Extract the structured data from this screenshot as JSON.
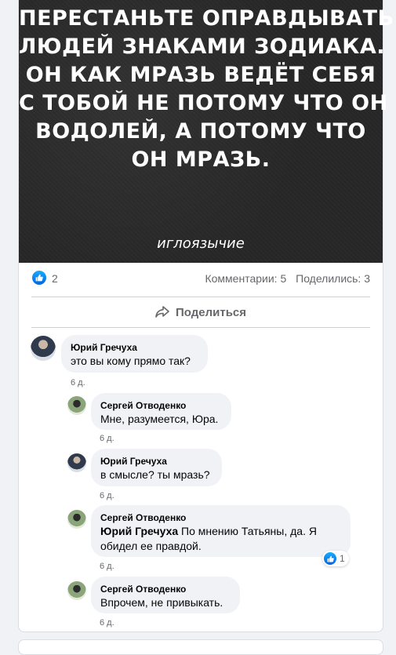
{
  "post": {
    "meme_lines": [
      "ПЕРЕСТАНЬТЕ ОПРАВДЫВАТЬ",
      "ЛЮДЕЙ ЗНАКАМИ ЗОДИАКА.",
      "ОН КАК МРАЗЬ ВЕДЁТ СЕБЯ",
      "С ТОБОЙ НЕ ПОТОМУ ЧТО ОН",
      "ВОДОЛЕЙ, А ПОТОМУ ЧТО",
      "ОН МРАЗЬ."
    ],
    "watermark": "иглоязычие",
    "likes": "2",
    "comments": "Комментарии: 5",
    "shares": "Поделились: 3",
    "share_label": "Поделиться"
  },
  "comments": [
    {
      "author": "Юрий Гречуха",
      "text": "это вы кому прямо так?",
      "time": "6 д."
    },
    {
      "author": "Сергей Отводенко",
      "text": "Мне, разумеется, Юра.",
      "time": "6 д."
    },
    {
      "author": "Юрий Гречуха",
      "text": "в смысле? ты мразь?",
      "time": "6 д."
    },
    {
      "author": "Сергей Отводенко",
      "mention": "Юрий Гречуха",
      "text": " По мнению Татьяны, да. Я обидел ее правдой.",
      "time": "6 д.",
      "reactions": "1"
    },
    {
      "author": "Сергей Отводенко",
      "text": "Впрочем, не привыкать.",
      "time": "6 д."
    }
  ],
  "colors": {
    "accent": "#1877f2",
    "bubble": "#f0f2f5",
    "secondary_text": "#65676b"
  }
}
